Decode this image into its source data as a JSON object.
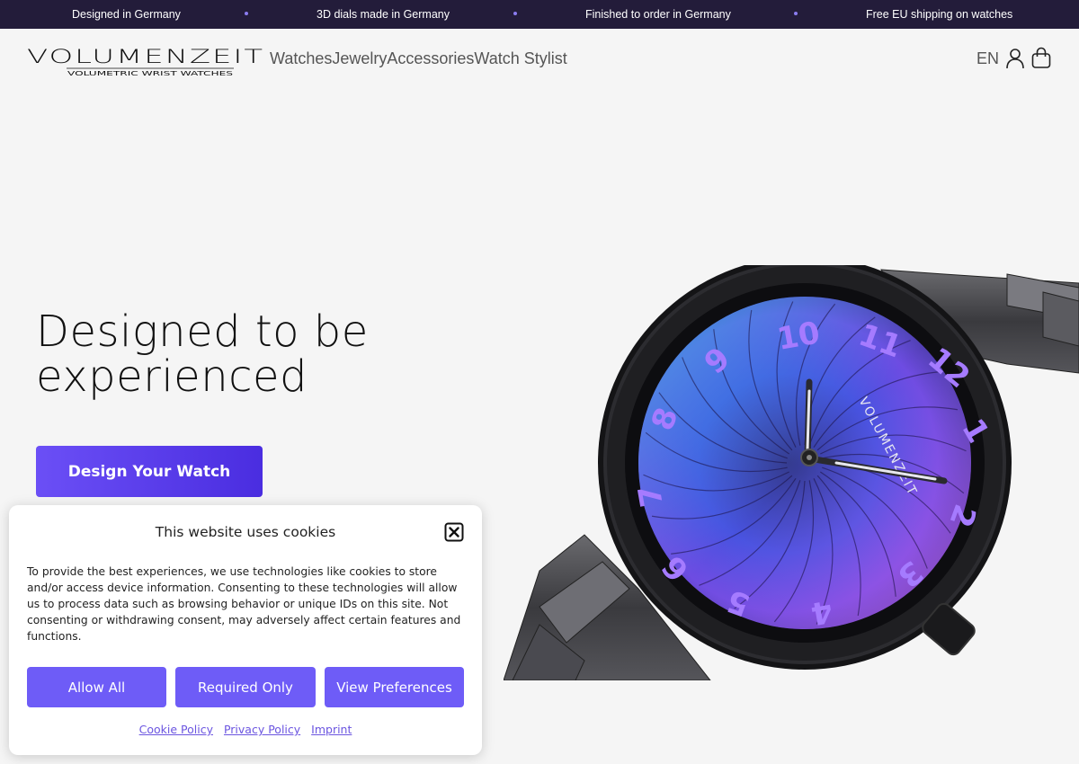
{
  "announcement": {
    "messages": [
      "Designed in Germany",
      "3D dials made in Germany",
      "Finished to order in Germany",
      "Free EU shipping on watches"
    ]
  },
  "header": {
    "logo_text": "VOLUMENZEIT",
    "logo_tagline": "VOLUMETRIC WRIST WATCHES",
    "nav": [
      "Watches",
      "Jewelry",
      "Accessories",
      "Watch Stylist"
    ],
    "language": "EN",
    "icons": [
      "account-icon",
      "bag-icon"
    ]
  },
  "hero": {
    "title_line1": "Designed to be",
    "title_line2": "experienced",
    "cta_label": "Design Your Watch",
    "watch_brand": "VOLUMENZEIT"
  },
  "cookie_banner": {
    "title": "This website uses cookies",
    "body": "To provide the best experiences, we use technologies like cookies to store and/or access device information. Consenting to these technologies will allow us to process data such as browsing behavior or unique IDs on this site. Not consenting or withdrawing consent, may adversely affect certain features and functions.",
    "buttons": [
      "Allow All",
      "Required Only",
      "View Preferences"
    ],
    "links": [
      "Cookie Policy",
      "Privacy Policy",
      "Imprint"
    ]
  },
  "colors": {
    "announcement_bg": "#231c3a",
    "accent": "#6e5cf7",
    "cta_gradient_start": "#6b4ff6",
    "cta_gradient_end": "#4a2de0"
  }
}
